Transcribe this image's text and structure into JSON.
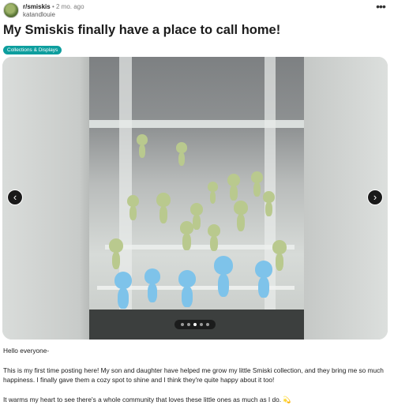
{
  "post": {
    "subreddit": "r/smiskis",
    "separator": "•",
    "time": "2 mo. ago",
    "username": "katandlouie",
    "more_icon_glyph": "•••",
    "title": "My Smiskis finally have a place to call home!",
    "flair": "Collections & Displays",
    "flair_color": "#0d9e9e",
    "gallery": {
      "prev_glyph": "‹",
      "next_glyph": "›",
      "current_index": 3,
      "total": 5
    },
    "body": [
      "Hello everyone-",
      "This is my first time posting here! My son and daughter have helped me grow my little Smiski collection, and they bring me so much happiness. I finally gave them a cozy spot to shine and I think they're quite happy about it too!",
      "It warms my heart to see there's a whole community that loves these little ones as much as I do. 💫"
    ]
  }
}
